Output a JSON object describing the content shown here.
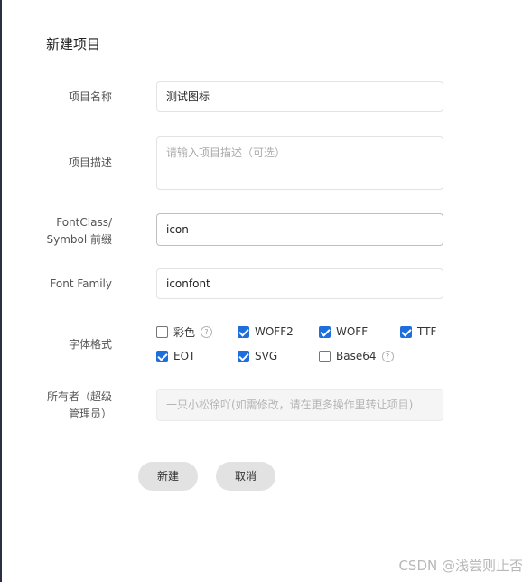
{
  "form": {
    "title": "新建项目",
    "name_label": "项目名称",
    "name_value": "测试图标",
    "desc_label": "项目描述",
    "desc_placeholder": "请输入项目描述（可选）",
    "prefix_label_line1": "FontClass/",
    "prefix_label_line2": "Symbol 前缀",
    "prefix_value": "icon-",
    "family_label": "Font Family",
    "family_value": "iconfont",
    "format_label": "字体格式",
    "formats": [
      {
        "label": "彩色",
        "checked": false,
        "help": "?"
      },
      {
        "label": "WOFF2",
        "checked": true
      },
      {
        "label": "WOFF",
        "checked": true
      },
      {
        "label": "TTF",
        "checked": true
      },
      {
        "label": "EOT",
        "checked": true
      },
      {
        "label": "SVG",
        "checked": true
      },
      {
        "label": "Base64",
        "checked": false,
        "help": "?"
      }
    ],
    "owner_label_line1": "所有者（超级",
    "owner_label_line2": "管理员）",
    "owner_value": "一只小松徐吖(如需修改，请在更多操作里转让项目)"
  },
  "actions": {
    "create_label": "新建",
    "cancel_label": "取消"
  },
  "watermark": "CSDN @浅尝则止否"
}
